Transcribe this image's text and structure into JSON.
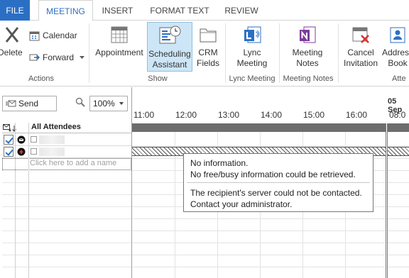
{
  "tabs": {
    "file": "FILE",
    "meeting": "MEETING",
    "insert": "INSERT",
    "format_text": "FORMAT TEXT",
    "review": "REVIEW"
  },
  "ribbon": {
    "actions": {
      "delete": "Delete",
      "calendar": "Calendar",
      "forward": "Forward",
      "label": "Actions"
    },
    "show": {
      "appointment": "Appointment",
      "scheduling_line1": "Scheduling",
      "scheduling_line2": "Assistant",
      "crm_line1": "CRM",
      "crm_line2": "Fields",
      "label": "Show"
    },
    "lync": {
      "line1": "Lync",
      "line2": "Meeting",
      "label": "Lync Meeting"
    },
    "notes": {
      "line1": "Meeting",
      "line2": "Notes",
      "label": "Meeting Notes"
    },
    "attendees": {
      "cancel_line1": "Cancel",
      "cancel_line2": "Invitation",
      "address_line1": "Address",
      "address_line2": "Book",
      "label": "Atte"
    }
  },
  "scheduling": {
    "send_label": "Send",
    "zoom": "100%",
    "all_attendees": "All Attendees",
    "add_name_placeholder": "Click here to add a name",
    "date": "05 Sep",
    "times": [
      "11:00",
      "12:00",
      "13:00",
      "14:00",
      "15:00",
      "16:00",
      "08:0"
    ]
  },
  "tooltip": {
    "line1": "No information.",
    "line2": "No free/busy information could be retrieved.",
    "line3": "The recipient's server could not be contacted.",
    "line4": "Contact your administrator."
  },
  "colors": {
    "accent": "#2b6fc4",
    "selected": "#cde6f7",
    "busy_bar": "#6d6d6d"
  }
}
